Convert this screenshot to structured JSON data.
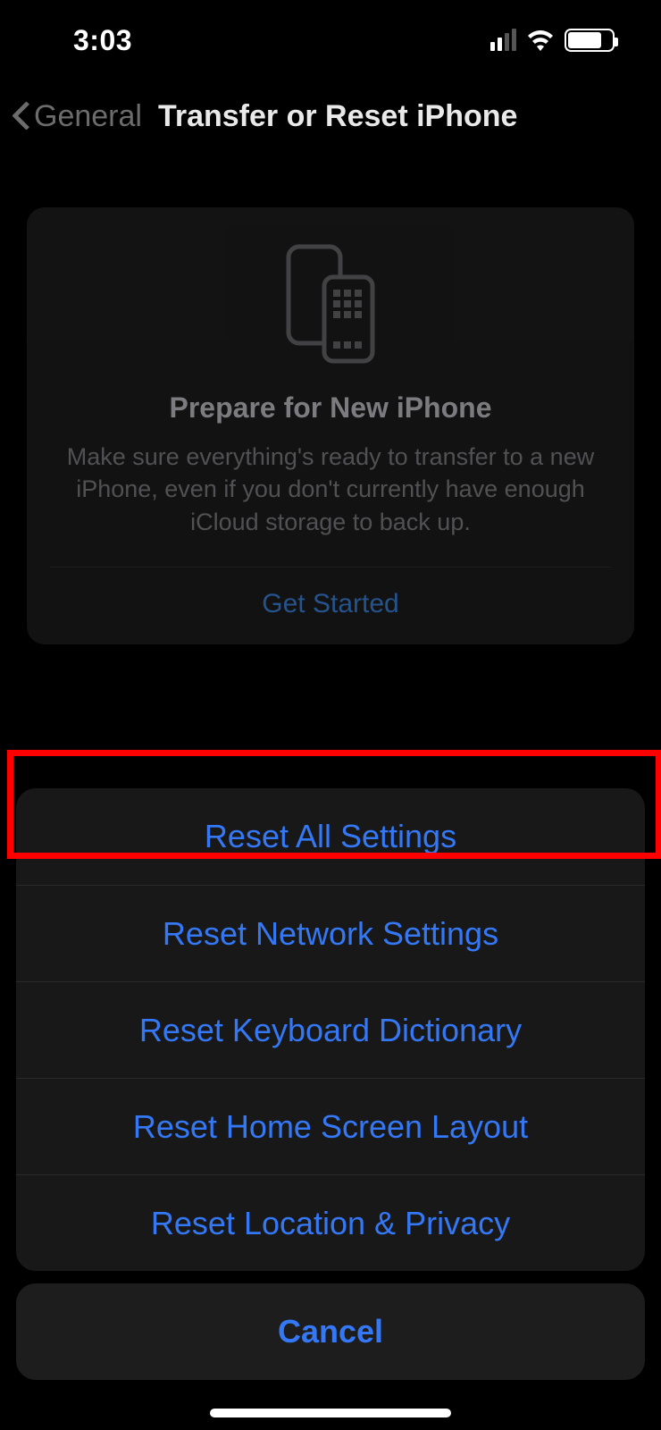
{
  "statusbar": {
    "time": "3:03"
  },
  "nav": {
    "back_label": "General",
    "title": "Transfer or Reset iPhone"
  },
  "prepare": {
    "title": "Prepare for New iPhone",
    "description": "Make sure everything's ready to transfer to a new iPhone, even if you don't currently have enough iCloud storage to back up.",
    "cta": "Get Started"
  },
  "sheet": {
    "items": [
      "Reset All Settings",
      "Reset Network Settings",
      "Reset Keyboard Dictionary",
      "Reset Home Screen Layout",
      "Reset Location & Privacy"
    ],
    "cancel": "Cancel"
  }
}
